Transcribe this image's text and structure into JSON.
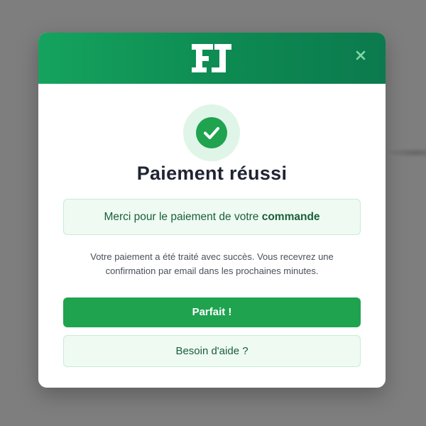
{
  "colors": {
    "accent": "#1fa34f",
    "header_gradient_start": "#15a35e",
    "header_gradient_end": "#0c7a4e",
    "soft_green_bg": "#eefaf2",
    "title_text": "#1f2432"
  },
  "header": {
    "logo_text": "FJ",
    "close_icon": "close-icon"
  },
  "status_icon": "check-circle-icon",
  "title": "Paiement réussi",
  "thanks": {
    "prefix": "Merci pour le paiement de votre ",
    "highlight": "commande"
  },
  "description": {
    "line1": "Votre paiement a été traité avec succès. Vous recevrez une",
    "line2": "confirmation par email dans les prochaines minutes."
  },
  "buttons": {
    "primary_label": "Parfait !",
    "secondary_label": "Besoin d'aide ?"
  }
}
